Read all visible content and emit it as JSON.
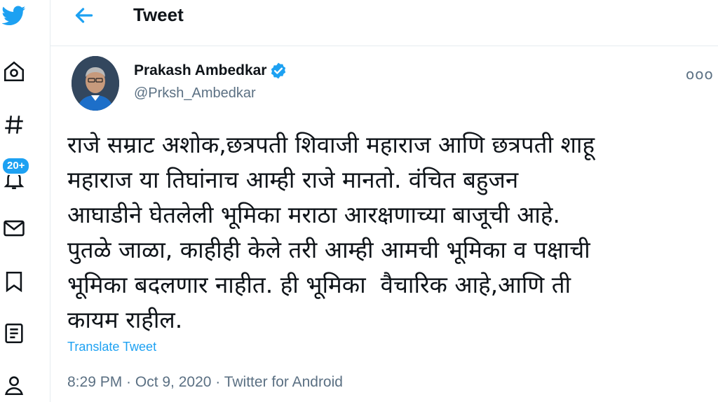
{
  "header": {
    "title": "Tweet",
    "back_icon": "back-arrow-icon"
  },
  "nav": {
    "items": [
      {
        "name": "twitter-logo-icon"
      },
      {
        "name": "home-icon"
      },
      {
        "name": "explore-hashtag-icon"
      },
      {
        "name": "notifications-bell-icon",
        "badge": "20+"
      },
      {
        "name": "messages-mail-icon"
      },
      {
        "name": "bookmarks-icon"
      },
      {
        "name": "lists-icon"
      },
      {
        "name": "profile-icon"
      }
    ]
  },
  "tweet": {
    "author_name": "Prakash Ambedkar",
    "author_handle": "@Prksh_Ambedkar",
    "text": "राजे सम्राट अशोक,छत्रपती शिवाजी महाराज आणि छत्रपती शाहू\nमहाराज या तिघांनाच आम्ही राजे मानतो. वंचित बहुजन\nआघाडीने घेतलेली भूमिका मराठा आरक्षणाच्या बाजूची आहे.\nपुतळे जाळा, काहीही केले तरी आम्ही आमची भूमिका व पक्षाची\nभूमिका बदलणार नाहीत. ही भूमिका  वैचारिक आहे,आणि ती\nकायम राहील.",
    "translate_label": "Translate Tweet",
    "timestamp": "8:29 PM · Oct 9, 2020 · Twitter for Android",
    "more_label": "ooo"
  },
  "colors": {
    "accent": "#1da1f2",
    "secondary_text": "#5b7083",
    "border": "#e6ecf0"
  }
}
